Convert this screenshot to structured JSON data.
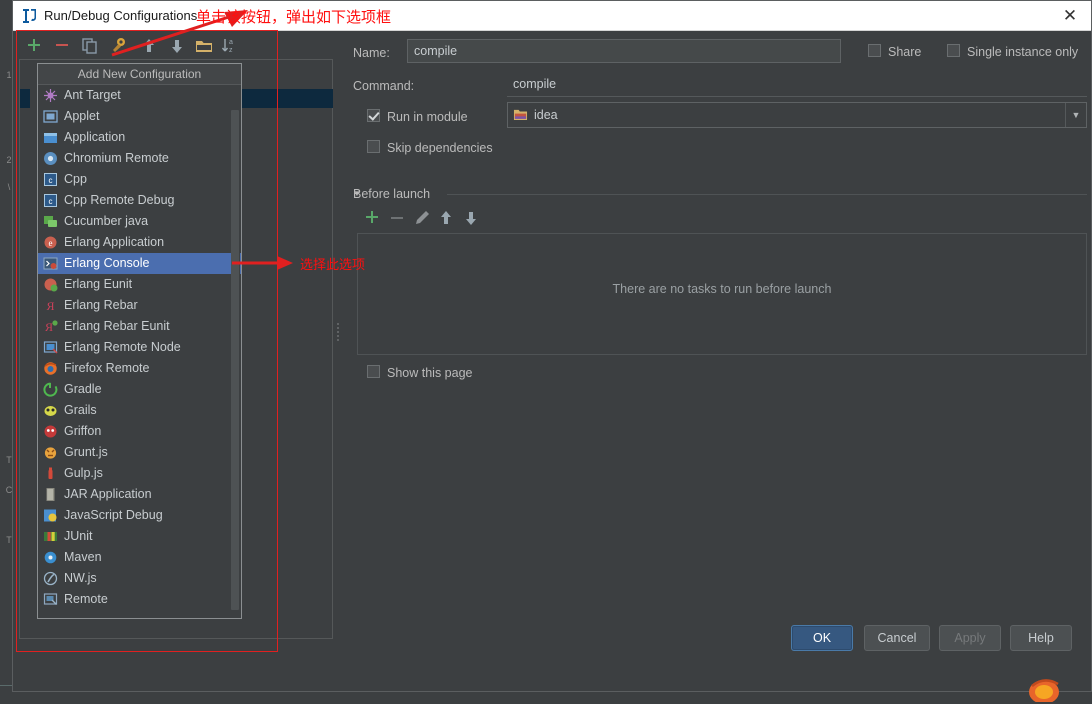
{
  "window": {
    "title": "Run/Debug Configurations",
    "app_icon": "intellij-idea-icon",
    "close_label": "✕"
  },
  "toolbar": {
    "buttons": [
      {
        "name": "add-configuration-button",
        "icon": "plus-icon",
        "label": "+"
      },
      {
        "name": "remove-configuration-button",
        "icon": "minus-icon",
        "label": "−"
      },
      {
        "name": "copy-configuration-button",
        "icon": "copy-icon",
        "label": "copy"
      },
      {
        "name": "edit-templates-button",
        "icon": "wrench-icon",
        "label": "templates"
      },
      {
        "name": "move-up-button",
        "icon": "arrow-up-icon",
        "label": "up"
      },
      {
        "name": "move-down-button",
        "icon": "arrow-down-icon",
        "label": "down"
      },
      {
        "name": "move-into-folder-button",
        "icon": "folder-icon",
        "label": "folder"
      },
      {
        "name": "sort-configurations-button",
        "icon": "sort-az-icon",
        "label": "sort"
      }
    ]
  },
  "popup": {
    "header": "Add New Configuration",
    "selected": "Erlang Console",
    "items": [
      {
        "label": "Ant Target",
        "icon": "ant-icon"
      },
      {
        "label": "Applet",
        "icon": "applet-icon"
      },
      {
        "label": "Application",
        "icon": "application-icon"
      },
      {
        "label": "Chromium Remote",
        "icon": "chromium-icon"
      },
      {
        "label": "Cpp",
        "icon": "cpp-icon"
      },
      {
        "label": "Cpp Remote Debug",
        "icon": "cpp-icon"
      },
      {
        "label": "Cucumber java",
        "icon": "cucumber-icon"
      },
      {
        "label": "Erlang Application",
        "icon": "erlang-icon"
      },
      {
        "label": "Erlang Console",
        "icon": "erlang-console-icon"
      },
      {
        "label": "Erlang Eunit",
        "icon": "erlang-eunit-icon"
      },
      {
        "label": "Erlang Rebar",
        "icon": "rebar-icon"
      },
      {
        "label": "Erlang Rebar Eunit",
        "icon": "rebar-eunit-icon"
      },
      {
        "label": "Erlang Remote Node",
        "icon": "remote-node-icon"
      },
      {
        "label": "Firefox Remote",
        "icon": "firefox-icon"
      },
      {
        "label": "Gradle",
        "icon": "gradle-icon"
      },
      {
        "label": "Grails",
        "icon": "grails-icon"
      },
      {
        "label": "Griffon",
        "icon": "griffon-icon"
      },
      {
        "label": "Grunt.js",
        "icon": "grunt-icon"
      },
      {
        "label": "Gulp.js",
        "icon": "gulp-icon"
      },
      {
        "label": "JAR Application",
        "icon": "jar-icon"
      },
      {
        "label": "JavaScript Debug",
        "icon": "javascript-icon"
      },
      {
        "label": "JUnit",
        "icon": "junit-icon"
      },
      {
        "label": "Maven",
        "icon": "maven-icon"
      },
      {
        "label": "NW.js",
        "icon": "nwjs-icon"
      },
      {
        "label": "Remote",
        "icon": "remote-icon"
      }
    ]
  },
  "form": {
    "name_label": "Name:",
    "name_value": "compile",
    "share_label": "Share",
    "share_checked": false,
    "single_instance_label": "Single instance only",
    "single_instance_checked": false,
    "command_label": "Command:",
    "command_value": "compile",
    "run_in_module_label": "Run in module",
    "run_in_module_checked": true,
    "module_value": "idea",
    "module_icon": "folder-icon",
    "module_arrow": "▼",
    "skip_dependencies_label": "Skip dependencies",
    "skip_dependencies_checked": false,
    "before_launch_label": "Before launch",
    "before_launch_arrow": "▼",
    "before_launch_empty": "There are no tasks to run before launch",
    "before_launch_buttons": [
      {
        "name": "add-task-button",
        "icon": "plus-icon"
      },
      {
        "name": "remove-task-button",
        "icon": "minus-icon"
      },
      {
        "name": "edit-task-button",
        "icon": "pencil-icon"
      },
      {
        "name": "task-move-up-button",
        "icon": "arrow-up-icon"
      },
      {
        "name": "task-move-down-button",
        "icon": "arrow-down-icon"
      }
    ],
    "show_this_page_label": "Show this page",
    "show_this_page_checked": false
  },
  "buttons": {
    "ok": "OK",
    "cancel": "Cancel",
    "apply": "Apply",
    "help": "Help"
  },
  "annotations": [
    {
      "name": "annotation-click-button",
      "text": "单击该按钮，弹出如下选项框"
    },
    {
      "name": "annotation-select-option",
      "text": "选择此选项"
    }
  ],
  "colors": {
    "accent": "#4b6eaf",
    "primary_button": "#365880",
    "annotation_red": "#ff0f0f",
    "dialog_bg": "#3c3f41",
    "field_bg": "#45494a"
  }
}
